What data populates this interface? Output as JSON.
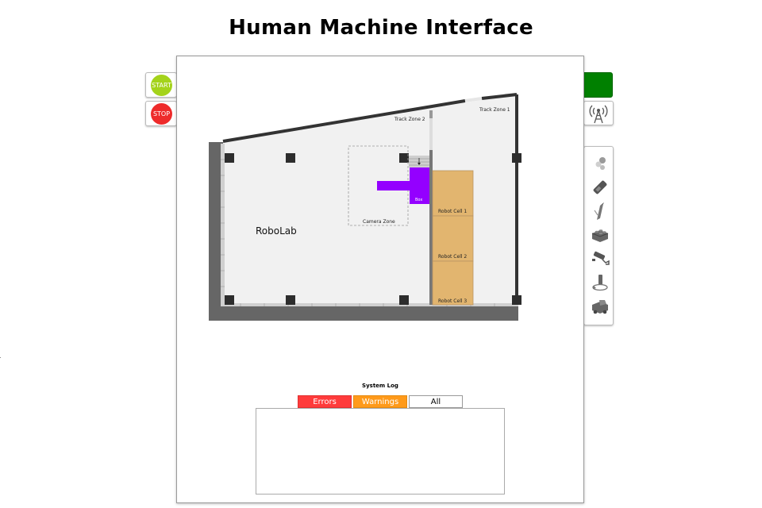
{
  "header": {
    "title": "Human Machine Interface"
  },
  "controls": {
    "start_label": "START",
    "stop_label": "STOP",
    "start_color": "#a4d31b",
    "stop_color": "#ee2b2b",
    "status_color": "#008000"
  },
  "toolbar": {
    "tools": [
      "robot-balls-icon",
      "battery-icon",
      "pen-tool-icon",
      "lego-brick-icon",
      "security-camera-icon",
      "rotating-device-icon",
      "truck-icon"
    ]
  },
  "map": {
    "lab_name": "RoboLab",
    "labels": {
      "track_zone_1": "Track Zone 1",
      "track_zone_2": "Track Zone 2",
      "camera_zone": "Camera Zone",
      "box": "Box",
      "robot_cell_1": "Robot Cell 1",
      "robot_cell_2": "Robot Cell 2",
      "robot_cell_3": "Robot Cell 3"
    },
    "colors": {
      "floor": "#f1f1f1",
      "wall": "#333333",
      "outer_wall": "#666666",
      "robot_cell": "#e2b56f",
      "box": "#9400ff"
    }
  },
  "log": {
    "title": "System Log",
    "tabs": [
      {
        "label": "Errors",
        "color": "#ff3b3b"
      },
      {
        "label": "Warnings",
        "color": "#ff9a1a"
      },
      {
        "label": "All",
        "color": "#ffffff"
      }
    ]
  }
}
